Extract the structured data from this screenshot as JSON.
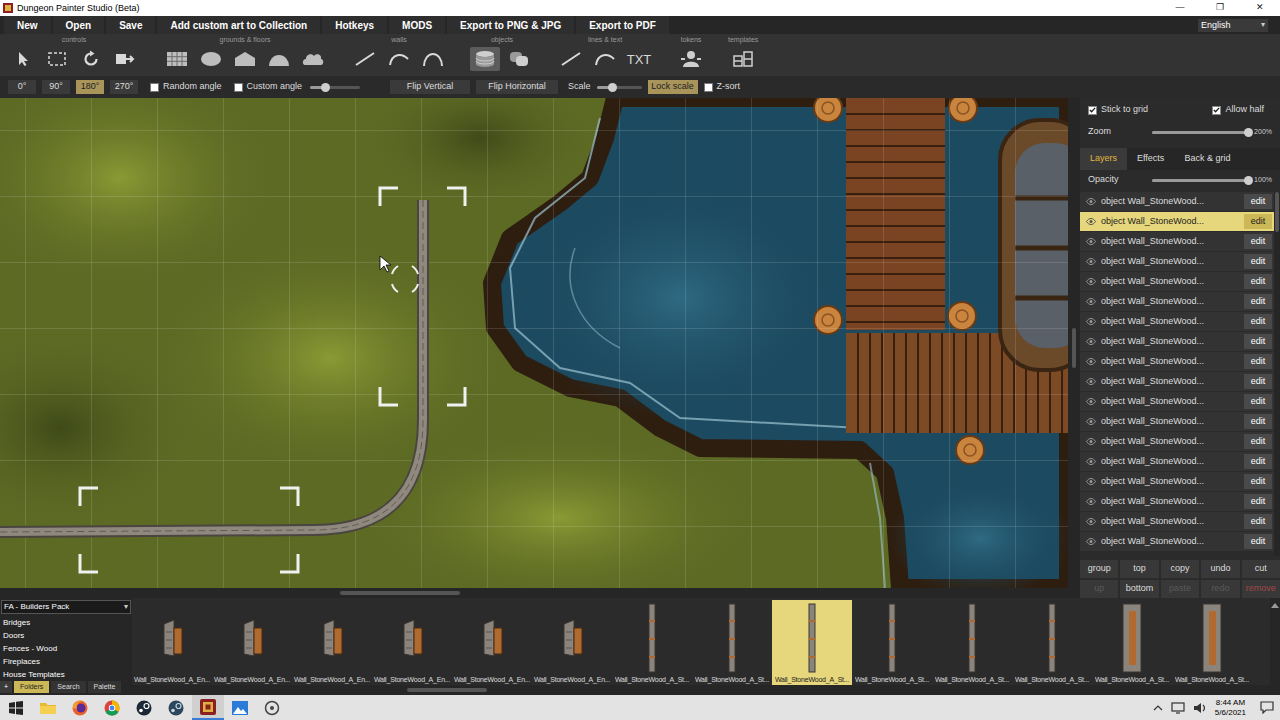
{
  "window": {
    "title": "Dungeon Painter Studio (Beta)",
    "controls": [
      "—",
      "❐",
      "✕"
    ]
  },
  "menu": [
    "New",
    "Open",
    "Save",
    "Add custom art to Collection",
    "Hotkeys",
    "MODS",
    "Export to PNG & JPG",
    "Export to PDF"
  ],
  "language": {
    "value": "English",
    "arrow": "▾"
  },
  "tool_groups": [
    {
      "label": "controls",
      "tools": [
        {
          "kind": "arrow",
          "selected": false
        },
        {
          "kind": "marquee",
          "selected": false
        },
        {
          "kind": "rotate",
          "selected": false
        },
        {
          "kind": "move",
          "selected": false
        }
      ]
    },
    {
      "label": "grounds & floors",
      "tools": [
        {
          "kind": "tile",
          "selected": false
        },
        {
          "kind": "ellipse",
          "selected": false
        },
        {
          "kind": "house",
          "selected": false
        },
        {
          "kind": "dome",
          "selected": false
        },
        {
          "kind": "cloud",
          "selected": false
        }
      ]
    },
    {
      "label": "walls",
      "tools": [
        {
          "kind": "line",
          "selected": false
        },
        {
          "kind": "curve",
          "selected": false
        },
        {
          "kind": "arc",
          "selected": false
        }
      ]
    },
    {
      "label": "objects",
      "tools": [
        {
          "kind": "objects",
          "selected": true
        },
        {
          "kind": "stack",
          "selected": false
        }
      ]
    },
    {
      "label": "lines & text",
      "tools": [
        {
          "kind": "line",
          "selected": false
        },
        {
          "kind": "curve",
          "selected": false
        },
        {
          "kind": "text",
          "label": "TXT",
          "selected": false
        }
      ]
    },
    {
      "label": "tokens",
      "tools": [
        {
          "kind": "token",
          "selected": false
        }
      ]
    },
    {
      "label": "templates",
      "tools": [
        {
          "kind": "template",
          "selected": false
        }
      ]
    }
  ],
  "transform": {
    "angles": [
      {
        "label": "0°",
        "selected": false
      },
      {
        "label": "90°",
        "selected": false
      },
      {
        "label": "180°",
        "selected": true
      },
      {
        "label": "270°",
        "selected": false
      }
    ],
    "random_angle": {
      "label": "Random angle",
      "checked": false
    },
    "custom_angle": {
      "label": "Custom angle",
      "checked": false,
      "level": 0.3
    },
    "flip_vertical": "Flip Vertical",
    "flip_horizontal": "Flip Horizontal",
    "scale": {
      "label": "Scale",
      "level": 0.35
    },
    "lock_scale": {
      "label": "Lock scale",
      "on": true
    },
    "z_sort": {
      "label": "Z-sort",
      "checked": false
    }
  },
  "panel": {
    "stick_to_grid": {
      "label": "Stick to grid",
      "checked": true
    },
    "allow_half": {
      "label": "Allow half",
      "checked": true
    },
    "zoom": {
      "label": "Zoom",
      "level": 1,
      "reading": "200%"
    },
    "tabs": [
      {
        "label": "Layers",
        "selected": true
      },
      {
        "label": "Effects",
        "selected": false
      },
      {
        "label": "Back & grid",
        "selected": false
      }
    ],
    "opacity": {
      "label": "Opacity",
      "level": 1,
      "reading": "100%"
    },
    "layers": [
      {
        "name": "object Wall_StoneWood...",
        "action": "edit",
        "visible": true,
        "selected": false
      },
      {
        "name": "object Wall_StoneWood...",
        "action": "edit",
        "visible": true,
        "selected": true
      },
      {
        "name": "object Wall_StoneWood...",
        "action": "edit",
        "visible": true,
        "selected": false
      },
      {
        "name": "object Wall_StoneWood...",
        "action": "edit",
        "visible": true,
        "selected": false
      },
      {
        "name": "object Wall_StoneWood...",
        "action": "edit",
        "visible": true,
        "selected": false
      },
      {
        "name": "object Wall_StoneWood...",
        "action": "edit",
        "visible": true,
        "selected": false
      },
      {
        "name": "object Wall_StoneWood...",
        "action": "edit",
        "visible": true,
        "selected": false
      },
      {
        "name": "object Wall_StoneWood...",
        "action": "edit",
        "visible": true,
        "selected": false
      },
      {
        "name": "object Wall_StoneWood...",
        "action": "edit",
        "visible": true,
        "selected": false
      },
      {
        "name": "object Wall_StoneWood...",
        "action": "edit",
        "visible": true,
        "selected": false
      },
      {
        "name": "object Wall_StoneWood...",
        "action": "edit",
        "visible": true,
        "selected": false
      },
      {
        "name": "object Wall_StoneWood...",
        "action": "edit",
        "visible": true,
        "selected": false
      },
      {
        "name": "object Wall_StoneWood...",
        "action": "edit",
        "visible": true,
        "selected": false
      },
      {
        "name": "object Wall_StoneWood...",
        "action": "edit",
        "visible": true,
        "selected": false
      },
      {
        "name": "object Wall_StoneWood...",
        "action": "edit",
        "visible": true,
        "selected": false
      },
      {
        "name": "object Wall_StoneWood...",
        "action": "edit",
        "visible": true,
        "selected": false
      },
      {
        "name": "object Wall_StoneWood...",
        "action": "edit",
        "visible": true,
        "selected": false
      },
      {
        "name": "object Wall_StoneWood...",
        "action": "edit",
        "visible": true,
        "selected": false
      }
    ],
    "buttons": [
      {
        "label": "group",
        "kind": "normal",
        "disabled": false
      },
      {
        "label": "top",
        "kind": "normal",
        "disabled": false
      },
      {
        "label": "copy",
        "kind": "normal",
        "disabled": false
      },
      {
        "label": "undo",
        "kind": "normal",
        "disabled": false
      },
      {
        "label": "cut",
        "kind": "normal",
        "disabled": false
      },
      {
        "label": "up",
        "kind": "normal",
        "disabled": true
      },
      {
        "label": "bottom",
        "kind": "normal",
        "disabled": false
      },
      {
        "label": "paste",
        "kind": "normal",
        "disabled": true
      },
      {
        "label": "redo",
        "kind": "normal",
        "disabled": true
      },
      {
        "label": "remove",
        "kind": "danger",
        "disabled": true
      }
    ]
  },
  "assets": {
    "pack": "FA - Builders Pack",
    "arrow": "▾",
    "folders": [
      "Bridges",
      "Doors",
      "Fences - Wood",
      "Fireplaces",
      "House Templates"
    ],
    "add": "+",
    "tabs": [
      {
        "label": "Folders",
        "selected": true
      },
      {
        "label": "Search",
        "selected": false
      },
      {
        "label": "Palette",
        "selected": false
      }
    ],
    "items": [
      {
        "label": "Wall_StoneWood_A_En...",
        "kind": "end",
        "selected": false
      },
      {
        "label": "Wall_StoneWood_A_En...",
        "kind": "end",
        "selected": false
      },
      {
        "label": "Wall_StoneWood_A_En...",
        "kind": "end",
        "selected": false
      },
      {
        "label": "Wall_StoneWood_A_En...",
        "kind": "end",
        "selected": false
      },
      {
        "label": "Wall_StoneWood_A_En...",
        "kind": "end",
        "selected": false
      },
      {
        "label": "Wall_StoneWood_A_En...",
        "kind": "end",
        "selected": false
      },
      {
        "label": "Wall_StoneWood_A_St...",
        "kind": "straight",
        "selected": false
      },
      {
        "label": "Wall_StoneWood_A_St...",
        "kind": "straight",
        "selected": false
      },
      {
        "label": "Wall_StoneWood_A_St...",
        "kind": "straight",
        "selected": true
      },
      {
        "label": "Wall_StoneWood_A_St...",
        "kind": "straight",
        "selected": false
      },
      {
        "label": "Wall_StoneWood_A_St...",
        "kind": "straight",
        "selected": false
      },
      {
        "label": "Wall_StoneWood_A_St...",
        "kind": "straight",
        "selected": false
      },
      {
        "label": "Wall_StoneWood_A_St...",
        "kind": "wide",
        "selected": false
      },
      {
        "label": "Wall_StoneWood_A_St...",
        "kind": "wide",
        "selected": false
      }
    ]
  },
  "taskbar": {
    "time": "8:44 AM",
    "date": "5/6/2021"
  }
}
